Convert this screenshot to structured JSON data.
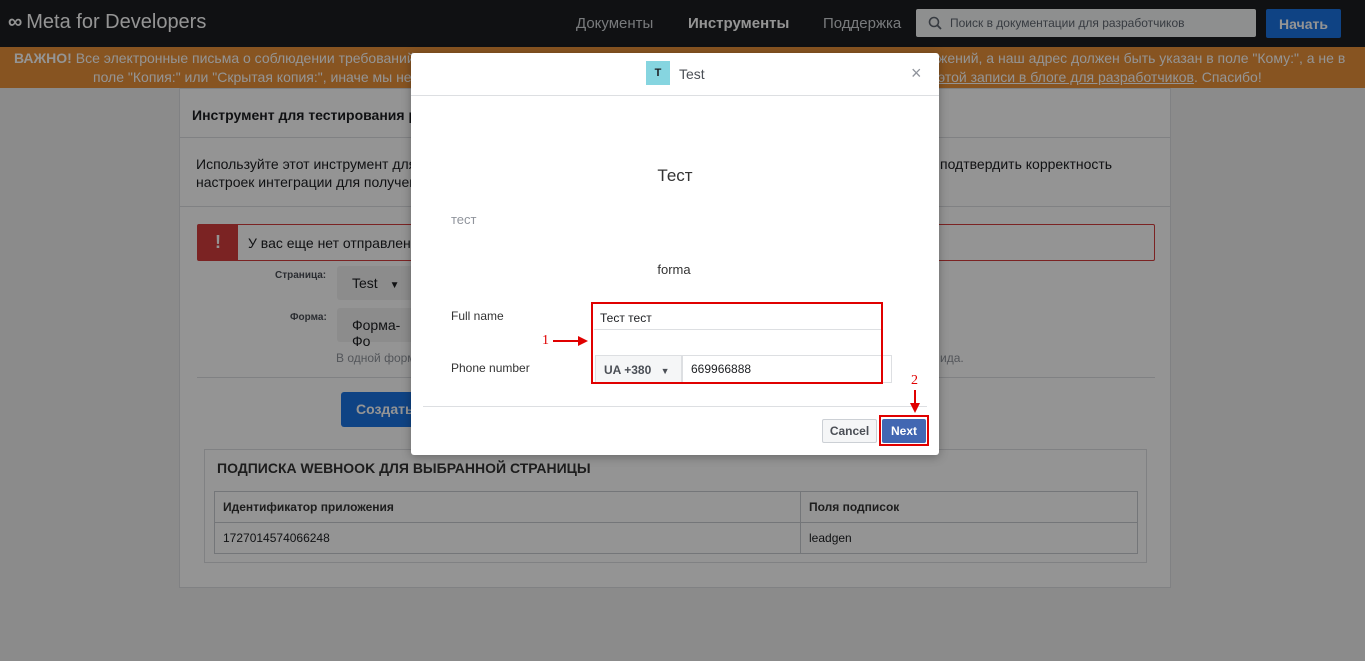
{
  "nav": {
    "logo": "Meta for Developers",
    "links": [
      "Документы",
      "Инструменты",
      "Поддержка"
    ],
    "search_placeholder": "Поиск в документации для разработчиков",
    "start": "Начать"
  },
  "banner": {
    "important": "ВАЖНО!",
    "line1_visible": " Все электронные письма о соблюдении требований",
    "line1_right": "жений, а наш адрес должен быть указан в поле \"Кому:\", а не в",
    "line2_left": "поле \"Копия:\" или \"Скрытая копия:\", иначе мы не м",
    "line2_link": "этой записи в блоге для разработчиков",
    "line2_end": ". Спасибо!"
  },
  "panel": {
    "title": "Инструмент для тестирования р",
    "desc_left1": "Используйте этот инструмент для",
    "desc_right1": "подтвердить корректность",
    "desc_left2": "настроек интеграции для получен",
    "alert_text": "У вас еще нет отправленн",
    "page_label": "Страница:",
    "page_value": "Test",
    "form_label": "Форма:",
    "form_value": "Форма-Фо",
    "hint_left": "В одной форм",
    "hint_right": "ида.",
    "create": "Создать"
  },
  "webhook": {
    "title": "ПОДПИСКА WEBHOOK ДЛЯ ВЫБРАННОЙ СТРАНИЦЫ",
    "columns": [
      "Идентификатор приложения",
      "Поля подписок"
    ],
    "rows": [
      [
        "1727014574066248",
        "leadgen"
      ]
    ]
  },
  "modal": {
    "avatar_letter": "T",
    "title": "Test",
    "close": "×",
    "form_heading": "Тест",
    "form_desc": "тест",
    "form_name": "forma",
    "full_name_label": "Full name",
    "full_name_value": "Тест тест",
    "phone_label": "Phone number",
    "country_code": "UA +380",
    "phone_value": "669966888",
    "cancel": "Cancel",
    "next": "Next"
  },
  "annotations": {
    "step1": "1",
    "step2": "2",
    "color": "#e00000"
  }
}
